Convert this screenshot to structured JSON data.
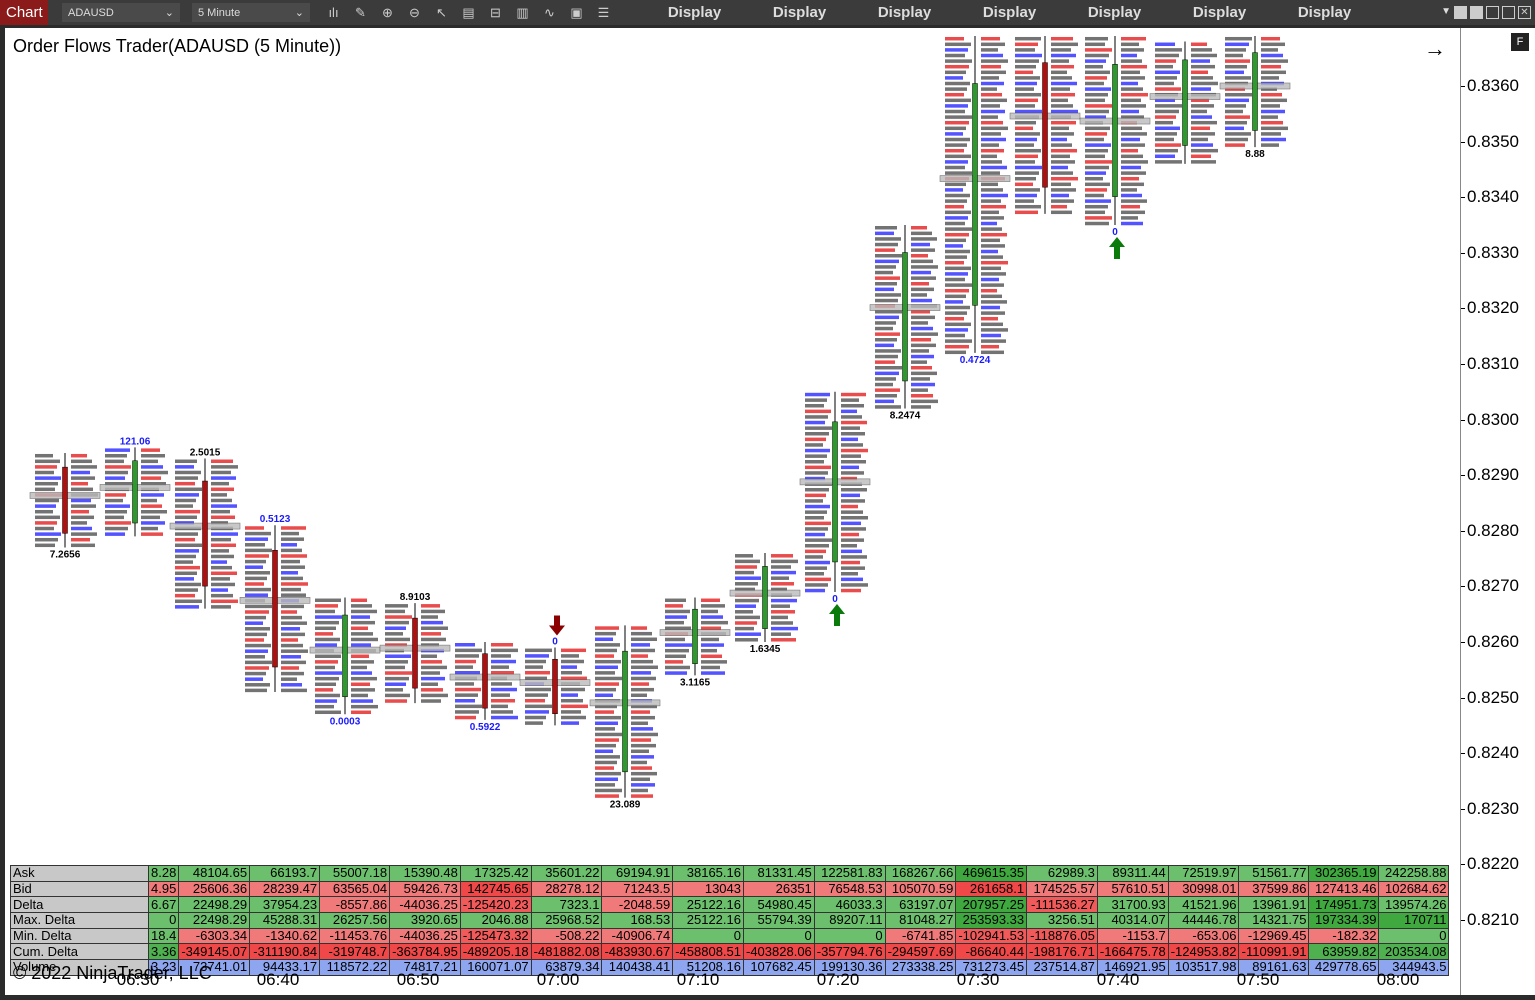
{
  "toolbar": {
    "tab": "Chart",
    "instrument": "ADAUSD",
    "interval": "5 Minute",
    "display_buttons": [
      "Display",
      "Display",
      "Display",
      "Display",
      "Display",
      "Display",
      "Display"
    ],
    "tools": [
      "bar-style-icon",
      "pencil-icon",
      "zoom-in-icon",
      "zoom-out-icon",
      "pointer-icon",
      "data-box-icon",
      "template-icon",
      "strategies-icon",
      "indicators-icon",
      "properties-icon",
      "list-icon"
    ]
  },
  "chart": {
    "title": "Order Flows Trader(ADAUSD (5 Minute))",
    "flag": "F",
    "price_labels": [
      "0.8360",
      "0.8350",
      "0.8340",
      "0.8330",
      "0.8320",
      "0.8310",
      "0.8300",
      "0.8290",
      "0.8280",
      "0.8270",
      "0.8260",
      "0.8250",
      "0.8240",
      "0.8230",
      "0.8220",
      "0.8210"
    ],
    "time_labels": [
      "06:30",
      "06:40",
      "06:50",
      "07:00",
      "07:10",
      "07:20",
      "07:30",
      "07:40",
      "07:50",
      "08:00"
    ],
    "colors": {
      "up": "#2e9a2e",
      "down": "#b01010",
      "ask": "#1a1aff",
      "bid": "#e01010"
    },
    "bars": [
      {
        "high": 0.8294,
        "low": 0.8277,
        "up": false,
        "label": "7.2656",
        "label_color": "black",
        "label_pos": "below"
      },
      {
        "high": 0.8295,
        "low": 0.8279,
        "up": true,
        "label": "121.06",
        "label_color": "blue",
        "label_pos": "above"
      },
      {
        "high": 0.8293,
        "low": 0.8266,
        "up": false,
        "label": "2.5015",
        "label_color": "black",
        "label_pos": "above"
      },
      {
        "high": 0.8281,
        "low": 0.8251,
        "up": false,
        "label": "0.5123",
        "label_color": "blue",
        "label_pos": "above"
      },
      {
        "high": 0.8268,
        "low": 0.8247,
        "up": true,
        "label": "0.0003",
        "label_color": "blue",
        "label_pos": "below"
      },
      {
        "high": 0.8267,
        "low": 0.8249,
        "up": false,
        "label": "8.9103",
        "label_color": "black",
        "label_pos": "above"
      },
      {
        "high": 0.826,
        "low": 0.8246,
        "up": false,
        "label": "0.5922",
        "label_color": "blue",
        "label_pos": "below"
      },
      {
        "high": 0.8259,
        "low": 0.8245,
        "up": false,
        "label": "0",
        "label_color": "blue",
        "label_pos": "above"
      },
      {
        "high": 0.8263,
        "low": 0.8232,
        "up": true,
        "label": "23.089",
        "label_color": "black",
        "label_pos": "below"
      },
      {
        "high": 0.8268,
        "low": 0.8254,
        "up": true,
        "label": "3.1165",
        "label_color": "black",
        "label_pos": "below"
      },
      {
        "high": 0.8276,
        "low": 0.826,
        "up": true,
        "label": "1.6345",
        "label_color": "black",
        "label_pos": "below"
      },
      {
        "high": 0.8305,
        "low": 0.8269,
        "up": true,
        "label": "0",
        "label_color": "blue",
        "label_pos": "below"
      },
      {
        "high": 0.8335,
        "low": 0.8302,
        "up": true,
        "label": "8.2474",
        "label_color": "black",
        "label_pos": "below"
      },
      {
        "high": 0.8369,
        "low": 0.8312,
        "up": true,
        "label": "0.4724",
        "label_color": "blue",
        "label_pos": "below"
      },
      {
        "high": 0.8369,
        "low": 0.8337,
        "up": false,
        "label": "",
        "label_color": "black",
        "label_pos": "below"
      },
      {
        "high": 0.8369,
        "low": 0.8335,
        "up": true,
        "label": "0",
        "label_color": "blue",
        "label_pos": "below"
      },
      {
        "high": 0.8368,
        "low": 0.8346,
        "up": true,
        "label": "",
        "label_color": "black",
        "label_pos": "below"
      },
      {
        "high": 0.8369,
        "low": 0.8349,
        "up": true,
        "label": "8.88",
        "label_color": "black",
        "label_pos": "below"
      }
    ],
    "signals": [
      {
        "bar": 7,
        "type": "down-arrow"
      },
      {
        "bar": 11,
        "type": "up-arrow"
      },
      {
        "bar": 15,
        "type": "up-arrow"
      }
    ]
  },
  "table": {
    "rows": [
      {
        "label": "Ask",
        "values": [
          "8.28",
          "48104.65",
          "66193.7",
          "55007.18",
          "15390.48",
          "17325.42",
          "35601.22",
          "69194.91",
          "38165.16",
          "81331.45",
          "122581.83",
          "168267.66",
          "469615.35",
          "62989.3",
          "89311.44",
          "72519.97",
          "51561.77",
          "302365.19",
          "242258.88"
        ]
      },
      {
        "label": "Bid",
        "values": [
          "4.95",
          "25606.36",
          "28239.47",
          "63565.04",
          "59426.73",
          "142745.65",
          "28278.12",
          "71243.5",
          "13043",
          "26351",
          "76548.53",
          "105070.59",
          "261658.1",
          "174525.57",
          "57610.51",
          "30998.01",
          "37599.86",
          "127413.46",
          "102684.62"
        ]
      },
      {
        "label": "Delta",
        "values": [
          "6.67",
          "22498.29",
          "37954.23",
          "-8557.86",
          "-44036.25",
          "-125420.23",
          "7323.1",
          "-2048.59",
          "25122.16",
          "54980.45",
          "46033.3",
          "63197.07",
          "207957.25",
          "-111536.27",
          "31700.93",
          "41521.96",
          "13961.91",
          "174951.73",
          "139574.26"
        ]
      },
      {
        "label": "Max. Delta",
        "values": [
          "0",
          "22498.29",
          "45288.31",
          "26257.56",
          "3920.65",
          "2046.88",
          "25968.52",
          "168.53",
          "25122.16",
          "55794.39",
          "89207.11",
          "81048.27",
          "253593.33",
          "3256.51",
          "40314.07",
          "44446.78",
          "14321.75",
          "197334.39",
          "170711"
        ]
      },
      {
        "label": "Min. Delta",
        "values": [
          "18.4",
          "-6303.34",
          "-1340.62",
          "-11453.76",
          "-44036.25",
          "-125473.32",
          "-508.22",
          "-40906.74",
          "0",
          "0",
          "0",
          "-6741.85",
          "-102941.53",
          "-118876.05",
          "-1153.7",
          "-653.06",
          "-12969.45",
          "-182.32",
          "0"
        ]
      },
      {
        "label": "Cum. Delta",
        "values": [
          "3.36",
          "-349145.07",
          "-311190.84",
          "-319748.7",
          "-363784.95",
          "-489205.18",
          "-481882.08",
          "-483930.67",
          "-458808.51",
          "-403828.06",
          "-357794.76",
          "-294597.69",
          "-86640.44",
          "-198176.71",
          "-166475.78",
          "-124953.82",
          "-110991.91",
          "63959.82",
          "203534.08"
        ]
      },
      {
        "label": "Volume",
        "values": [
          "3.23",
          "73741.01",
          "94433.17",
          "118572.22",
          "74817.21",
          "160071.07",
          "63879.34",
          "140438.41",
          "51208.16",
          "107682.45",
          "199130.36",
          "273338.25",
          "731273.45",
          "237514.87",
          "146921.95",
          "103517.98",
          "89161.63",
          "429778.65",
          "344943.5"
        ]
      }
    ]
  },
  "copyright": "© 2022 NinjaTrader, LLC"
}
